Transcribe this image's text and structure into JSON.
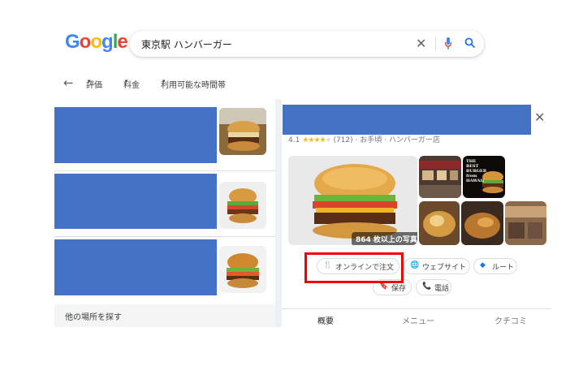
{
  "logo": {
    "letters": [
      "G",
      "o",
      "o",
      "g",
      "l",
      "e"
    ]
  },
  "search": {
    "query": "東京駅 ハンバーガー"
  },
  "filters": {
    "rating": "評価",
    "price": "料金",
    "hours": "利用可能な時間帯"
  },
  "left": {
    "more_places": "他の場所を探す"
  },
  "detail": {
    "rating_value": "4.1",
    "stars": "★★★★",
    "star_empty": "★",
    "review_count": "(712)",
    "meta": "· お手頃 · ハンバーガー店",
    "photo_count": "864 枚以上の写真",
    "poster_text": "THE BEST BURGER from HAWAII",
    "actions": {
      "order": "オンラインで注文",
      "website": "ウェブサイト",
      "route": "ルート",
      "save": "保存",
      "call": "電話"
    },
    "tabs": {
      "overview": "概要",
      "menu": "メニュー",
      "reviews": "クチコミ"
    }
  },
  "colors": {
    "redact": "#4472c4",
    "highlight": "#ee0000",
    "accent": "#1a73e8"
  }
}
